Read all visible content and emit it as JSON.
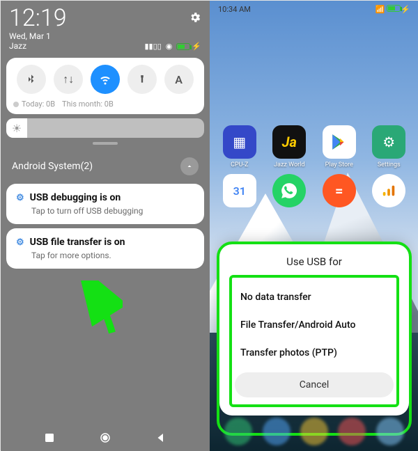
{
  "left": {
    "clock": "12:19",
    "date": "Wed, Mar 1",
    "carrier": "Jazz",
    "qs": {
      "data_today": "Today: 0B",
      "data_month": "This month: 0B"
    },
    "group_title": "Android System(2)",
    "notifications": [
      {
        "title": "USB debugging is on",
        "subtitle": "Tap to turn off USB debugging"
      },
      {
        "title": "USB file transfer is on",
        "subtitle": "Tap for more options."
      }
    ]
  },
  "right": {
    "status_time": "10:34 AM",
    "apps_row1": [
      {
        "label": "CPU-Z",
        "bg": "#3448c8",
        "glyph": "▦"
      },
      {
        "label": "Jazz World",
        "bg": "#111",
        "glyph": "J"
      },
      {
        "label": "Play Store",
        "bg": "#fff",
        "glyph": "▶"
      },
      {
        "label": "Settings",
        "bg": "#2aa876",
        "glyph": "⚙"
      }
    ],
    "apps_row2": [
      {
        "label": "",
        "bg": "#fff",
        "glyph": "31"
      },
      {
        "label": "",
        "bg": "#25d366",
        "glyph": "✆"
      },
      {
        "label": "",
        "bg": "#ff5722",
        "glyph": "≡"
      },
      {
        "label": "",
        "bg": "#fff",
        "glyph": "📊"
      }
    ],
    "sheet": {
      "title": "Use USB for",
      "options": [
        "No data transfer",
        "File Transfer/Android Auto",
        "Transfer photos (PTP)"
      ],
      "cancel": "Cancel"
    }
  }
}
